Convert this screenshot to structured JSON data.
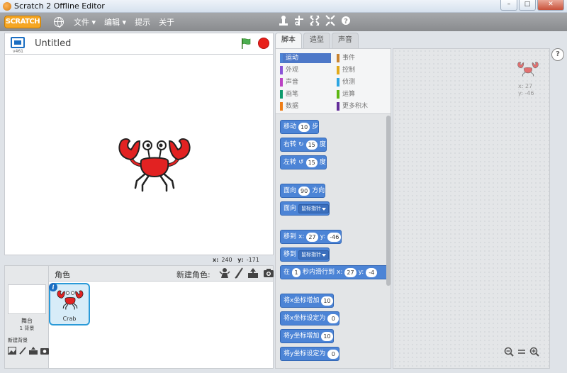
{
  "window": {
    "title": "Scratch 2 Offline Editor",
    "controls": [
      "–",
      "□",
      "✕"
    ]
  },
  "menubar": {
    "logo": "SCRATCH",
    "items": [
      "文件 ▾",
      "编辑 ▾",
      "提示",
      "关于"
    ],
    "toolbar_icons": [
      "duplicate-icon",
      "cut-icon",
      "grow-icon",
      "shrink-icon",
      "help-icon"
    ]
  },
  "stage": {
    "version": "v461",
    "project_name": "Untitled",
    "coord_x_label": "x:",
    "coord_x": "240",
    "coord_y_label": "y:",
    "coord_y": "-171"
  },
  "sprites": {
    "title": "角色",
    "new_sprite_label": "新建角色:",
    "stage_label": "舞台",
    "backdrop_count": "1 背景",
    "new_backdrop_label": "新建背景",
    "items": [
      {
        "name": "Crab"
      }
    ]
  },
  "tabs": [
    "脚本",
    "造型",
    "声音"
  ],
  "categories": [
    {
      "label": "运动",
      "color": "#4c84d6",
      "active": true
    },
    {
      "label": "事件",
      "color": "#c88330"
    },
    {
      "label": "外观",
      "color": "#8a55d7"
    },
    {
      "label": "控制",
      "color": "#e1a91a"
    },
    {
      "label": "声音",
      "color": "#bb42c3"
    },
    {
      "label": "侦测",
      "color": "#2ca5e2"
    },
    {
      "label": "画笔",
      "color": "#0e9a6c"
    },
    {
      "label": "运算",
      "color": "#5cb712"
    },
    {
      "label": "数据",
      "color": "#ee7d16"
    },
    {
      "label": "更多积木",
      "color": "#632d99"
    }
  ],
  "blocks": {
    "move": {
      "label": "移动",
      "value": "10",
      "suffix": "步"
    },
    "turn_right": {
      "label": "右转",
      "value": "15",
      "suffix": "度"
    },
    "turn_left": {
      "label": "左转",
      "value": "15",
      "suffix": "度"
    },
    "point_dir": {
      "label": "面向",
      "value": "90",
      "suffix": "方向"
    },
    "point_towards": {
      "label": "面向",
      "option": "鼠标指针"
    },
    "goto_xy": {
      "label": "移到",
      "x_label": "x:",
      "x": "27",
      "y_label": "y:",
      "y": "-46"
    },
    "goto": {
      "label": "移到",
      "option": "鼠标指针"
    },
    "glide": {
      "label": "在",
      "secs": "1",
      "mid": "秒内滑行到",
      "x_label": "x:",
      "x": "27",
      "y_label": "y:",
      "y": "-4"
    },
    "change_x": {
      "label": "将x坐标增加",
      "value": "10"
    },
    "set_x": {
      "label": "将x坐标设定为",
      "value": "0"
    },
    "change_y": {
      "label": "将y坐标增加",
      "value": "10"
    },
    "set_y": {
      "label": "将y坐标设定为",
      "value": "0"
    }
  },
  "script_area": {
    "x_label": "x:",
    "x": "27",
    "y_label": "y:",
    "y": "-46"
  },
  "colors": {
    "motion": "#4c84d6",
    "menubar": "#999b9e",
    "stop": "#e8201a",
    "flag": "#4caf50",
    "crab": "#e22222"
  }
}
